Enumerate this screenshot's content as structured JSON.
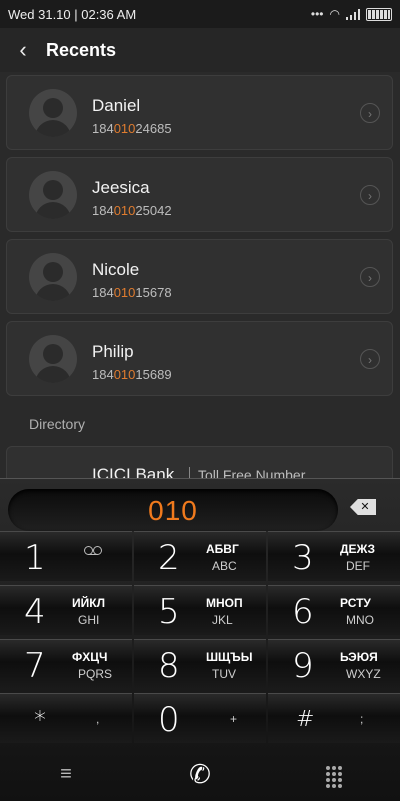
{
  "status": {
    "time": "Wed 31.10 | 02:36 AM"
  },
  "header": {
    "title": "Recents",
    "back": "‹"
  },
  "recents": [
    {
      "name": "Daniel",
      "num_pre": "184",
      "num_hl": "010",
      "num_post": "24685"
    },
    {
      "name": "Jeesica",
      "num_pre": "184",
      "num_hl": "010",
      "num_post": "25042"
    },
    {
      "name": "Nicole",
      "num_pre": "184",
      "num_hl": "010",
      "num_post": "15678"
    },
    {
      "name": "Philip",
      "num_pre": "184",
      "num_hl": "010",
      "num_post": "15689"
    }
  ],
  "directory": {
    "label": "Directory",
    "name": "ICICI Bank",
    "sub": "Toll Free Number"
  },
  "dialer": {
    "value": "010",
    "delete": "✕",
    "keys": [
      {
        "digit": "1",
        "l1": "",
        "l2": ""
      },
      {
        "digit": "2",
        "l1": "АБВГ",
        "l2": "ABC"
      },
      {
        "digit": "3",
        "l1": "ДЕЖЗ",
        "l2": "DEF"
      },
      {
        "digit": "4",
        "l1": "ИЙКЛ",
        "l2": "GHI"
      },
      {
        "digit": "5",
        "l1": "МНОП",
        "l2": "JKL"
      },
      {
        "digit": "6",
        "l1": "РСТУ",
        "l2": "MNO"
      },
      {
        "digit": "7",
        "l1": "ФХЦЧ",
        "l2": "PQRS"
      },
      {
        "digit": "8",
        "l1": "ШЩЪЫ",
        "l2": "TUV"
      },
      {
        "digit": "9",
        "l1": "ЬЭЮЯ",
        "l2": "WXYZ"
      },
      {
        "digit": "*",
        "l1": "",
        "l2": ","
      },
      {
        "digit": "0",
        "l1": "",
        "l2": "+"
      },
      {
        "digit": "#",
        "l1": "",
        "l2": ";"
      }
    ],
    "menu_icon": "≡",
    "call_icon": "✆"
  }
}
